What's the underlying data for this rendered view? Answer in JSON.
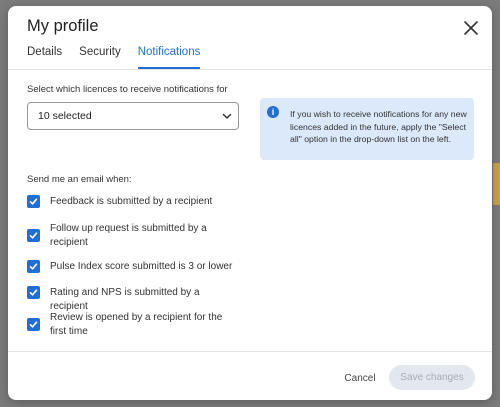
{
  "dialog": {
    "title": "My profile"
  },
  "tabs": [
    {
      "label": "Details"
    },
    {
      "label": "Security"
    },
    {
      "label": "Notifications",
      "active": true
    }
  ],
  "licences": {
    "label": "Select which licences to receive notifications for",
    "selected": "10 selected"
  },
  "info": {
    "text": "If you wish to receive notifications for any new licences added in the future, apply the \"Select all\" option in the drop-down list on the left."
  },
  "email": {
    "label": "Send me an email when:",
    "options": [
      {
        "label": "Feedback is submitted by a recipient",
        "checked": true
      },
      {
        "label": "Follow up request is submitted by a recipient",
        "checked": true
      },
      {
        "label": "Pulse Index score submitted is 3 or lower",
        "checked": true
      },
      {
        "label": "Rating and NPS is submitted by a recipient",
        "checked": true
      },
      {
        "label": "Review is opened by a recipient for the first time",
        "checked": true
      }
    ]
  },
  "footer": {
    "cancel_label": "Cancel",
    "save_label": "Save changes"
  },
  "colors": {
    "accent": "#1f6fd6",
    "info_bg": "#dce9fb",
    "disabled_bg": "#e3e8ee"
  },
  "icons": [
    "close-icon",
    "chevron-down-icon",
    "info-icon",
    "checkmark-icon"
  ]
}
